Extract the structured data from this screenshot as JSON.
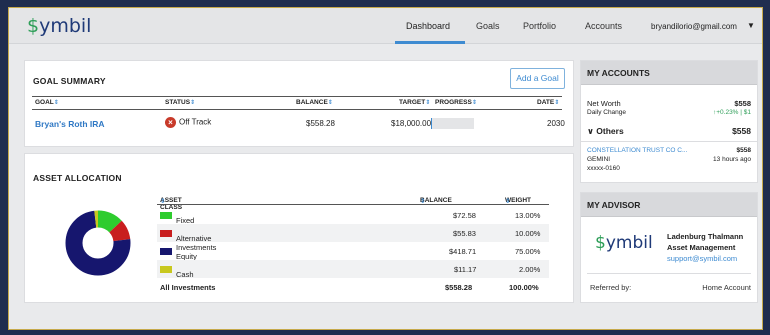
{
  "brand": {
    "dollar": "$",
    "name": "ymbil"
  },
  "nav": {
    "tabs": [
      "Dashboard",
      "Goals",
      "Portfolio",
      "Accounts"
    ],
    "active": "Dashboard",
    "user_email": "bryandilorio@gmail.com",
    "caret": "▼"
  },
  "goal_summary": {
    "title": "GOAL SUMMARY",
    "add_button": "Add a Goal",
    "columns": {
      "goal": "GOAL",
      "status": "STATUS",
      "balance": "BALANCE",
      "target": "TARGET",
      "progress": "PROGRESS",
      "date": "DATE"
    },
    "sort_glyph": "⇕",
    "rows": [
      {
        "goal": "Bryan's Roth IRA",
        "status": "Off Track",
        "status_icon": "x-circle-icon",
        "balance": "$558.28",
        "target": "$18,000.00",
        "progress": 0.03,
        "date": "2030"
      }
    ]
  },
  "asset_allocation": {
    "title": "ASSET ALLOCATION",
    "columns": {
      "asset_class": "ASSET CLASS",
      "balance": "BALANCE",
      "weight": "WEIGHT"
    },
    "rows": [
      {
        "name": "Fixed Income",
        "color": "#2ecc2e",
        "balance": "$72.58",
        "weight": "13.00%",
        "pct": 13
      },
      {
        "name": "Alternative Investments",
        "color": "#c81e1e",
        "balance": "$55.83",
        "weight": "10.00%",
        "pct": 10
      },
      {
        "name": "Equity",
        "color": "#16166e",
        "balance": "$418.71",
        "weight": "75.00%",
        "pct": 75
      },
      {
        "name": "Cash",
        "color": "#c8c81e",
        "balance": "$11.17",
        "weight": "2.00%",
        "pct": 2
      }
    ],
    "total": {
      "label": "All Investments",
      "balance": "$558.28",
      "weight": "100.00%"
    }
  },
  "my_accounts": {
    "title": "MY ACCOUNTS",
    "net_worth_label": "Net Worth",
    "net_worth": "$558",
    "daily_change_label": "Daily Change",
    "daily_change": "↑+0.23% | $1",
    "others_label": "Others",
    "others_caret": "∨",
    "others_value": "$558",
    "account_name": "CONSTELLATION TRUST CO C...",
    "account_value": "$558",
    "account_institution": "GEMINI",
    "account_time": "13 hours ago",
    "account_number": "xxxxx-0160"
  },
  "my_advisor": {
    "title": "MY ADVISOR",
    "firm_line1": "Ladenburg Thalmann",
    "firm_line2": "Asset Management",
    "email": "support@symbil.com",
    "referred_label": "Referred by:",
    "referred_value": "Home Account"
  }
}
